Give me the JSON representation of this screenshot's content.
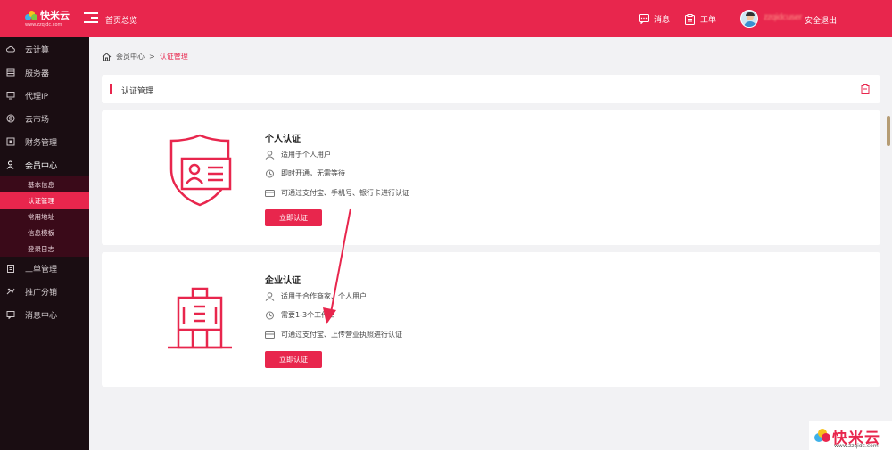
{
  "header": {
    "logo_text": "快米云",
    "logo_sub": "www.zzqidc.com",
    "home_label": "首页总览",
    "messages_label": "消息",
    "tickets_label": "工单",
    "username": "zzqidcuser",
    "separator": "|",
    "logout_label": "安全退出"
  },
  "sidebar": {
    "items": [
      {
        "label": "云计算",
        "icon": "cloud-icon"
      },
      {
        "label": "服务器",
        "icon": "server-icon"
      },
      {
        "label": "代理IP",
        "icon": "monitor-icon"
      },
      {
        "label": "云市场",
        "icon": "market-icon"
      },
      {
        "label": "财务管理",
        "icon": "finance-icon"
      },
      {
        "label": "会员中心",
        "icon": "user-icon"
      }
    ],
    "sub_items": [
      {
        "label": "基本信息"
      },
      {
        "label": "认证管理"
      },
      {
        "label": "常用地址"
      },
      {
        "label": "信息模板"
      },
      {
        "label": "登录日志"
      }
    ],
    "items_after": [
      {
        "label": "工单管理",
        "icon": "clipboard-icon"
      },
      {
        "label": "推广分销",
        "icon": "share-icon"
      },
      {
        "label": "消息中心",
        "icon": "message-icon"
      }
    ]
  },
  "breadcrumb": {
    "root": "会员中心",
    "sep": ">",
    "current": "认证管理"
  },
  "panel": {
    "title": "认证管理"
  },
  "cards": [
    {
      "title": "个人认证",
      "features": [
        "适用于个人用户",
        "即时开通，无需等待",
        "可通过支付宝、手机号、银行卡进行认证"
      ],
      "button": "立即认证"
    },
    {
      "title": "企业认证",
      "features": [
        "适用于合作商家、个人用户",
        "需要1-3个工作日",
        "可通过支付宝、上传营业执照进行认证"
      ],
      "button": "立即认证"
    }
  ],
  "watermark": {
    "text": "快米云",
    "url": "www.zzqidc.com"
  },
  "colors": {
    "brand": "#e8264d",
    "sidebar_bg": "#1a0d12"
  }
}
